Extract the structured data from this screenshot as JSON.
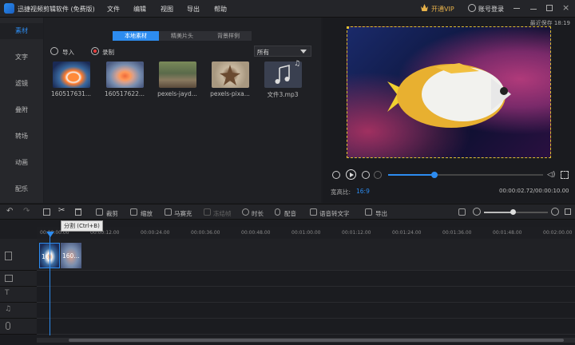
{
  "app": {
    "title": "迅捷视频剪辑软件 (免费版)",
    "menu": [
      "文件",
      "编辑",
      "视图",
      "导出",
      "帮助"
    ],
    "vip_label": "开通VIP",
    "login_label": "账号登录"
  },
  "sidebar": {
    "items": [
      {
        "label": "素材"
      },
      {
        "label": "文字"
      },
      {
        "label": "滤镜"
      },
      {
        "label": "叠附"
      },
      {
        "label": "转场"
      },
      {
        "label": "动画"
      },
      {
        "label": "配乐"
      }
    ]
  },
  "media": {
    "tabs": [
      "本地素材",
      "精美片头",
      "背景样例"
    ],
    "import_label": "导入",
    "record_label": "录制",
    "filter_value": "所有",
    "items": [
      {
        "label": "160517631..."
      },
      {
        "label": "160517622..."
      },
      {
        "label": "pexels-jayd..."
      },
      {
        "label": "pexels-pixa..."
      },
      {
        "label": "文件3.mp3"
      }
    ]
  },
  "preview": {
    "autosave": "最近保存 18:19",
    "aspect_label": "宽高比:",
    "aspect_value": "16:9",
    "time_current": "00:00:02.72",
    "time_total": "00:00:10.00",
    "progress": 0.3
  },
  "toolbar": {
    "tooltip": "分割 (Ctrl+B)",
    "tools": [
      "裁剪",
      "缩放",
      "马赛克",
      "冻结帧",
      "时长",
      "配音",
      "语音转文字",
      "导出"
    ]
  },
  "timeline": {
    "ticks": [
      "00:00:00.00",
      "00:00:12.00",
      "00:00:24.00",
      "00:00:36.00",
      "00:00:48.00",
      "00:01:00.00",
      "00:01:12.00",
      "00:01:24.00",
      "00:01:36.00",
      "00:01:48.00",
      "00:02:00.00"
    ],
    "clips": [
      {
        "label": "16"
      },
      {
        "label": "160..."
      }
    ],
    "zoom_level": 0.45
  }
}
